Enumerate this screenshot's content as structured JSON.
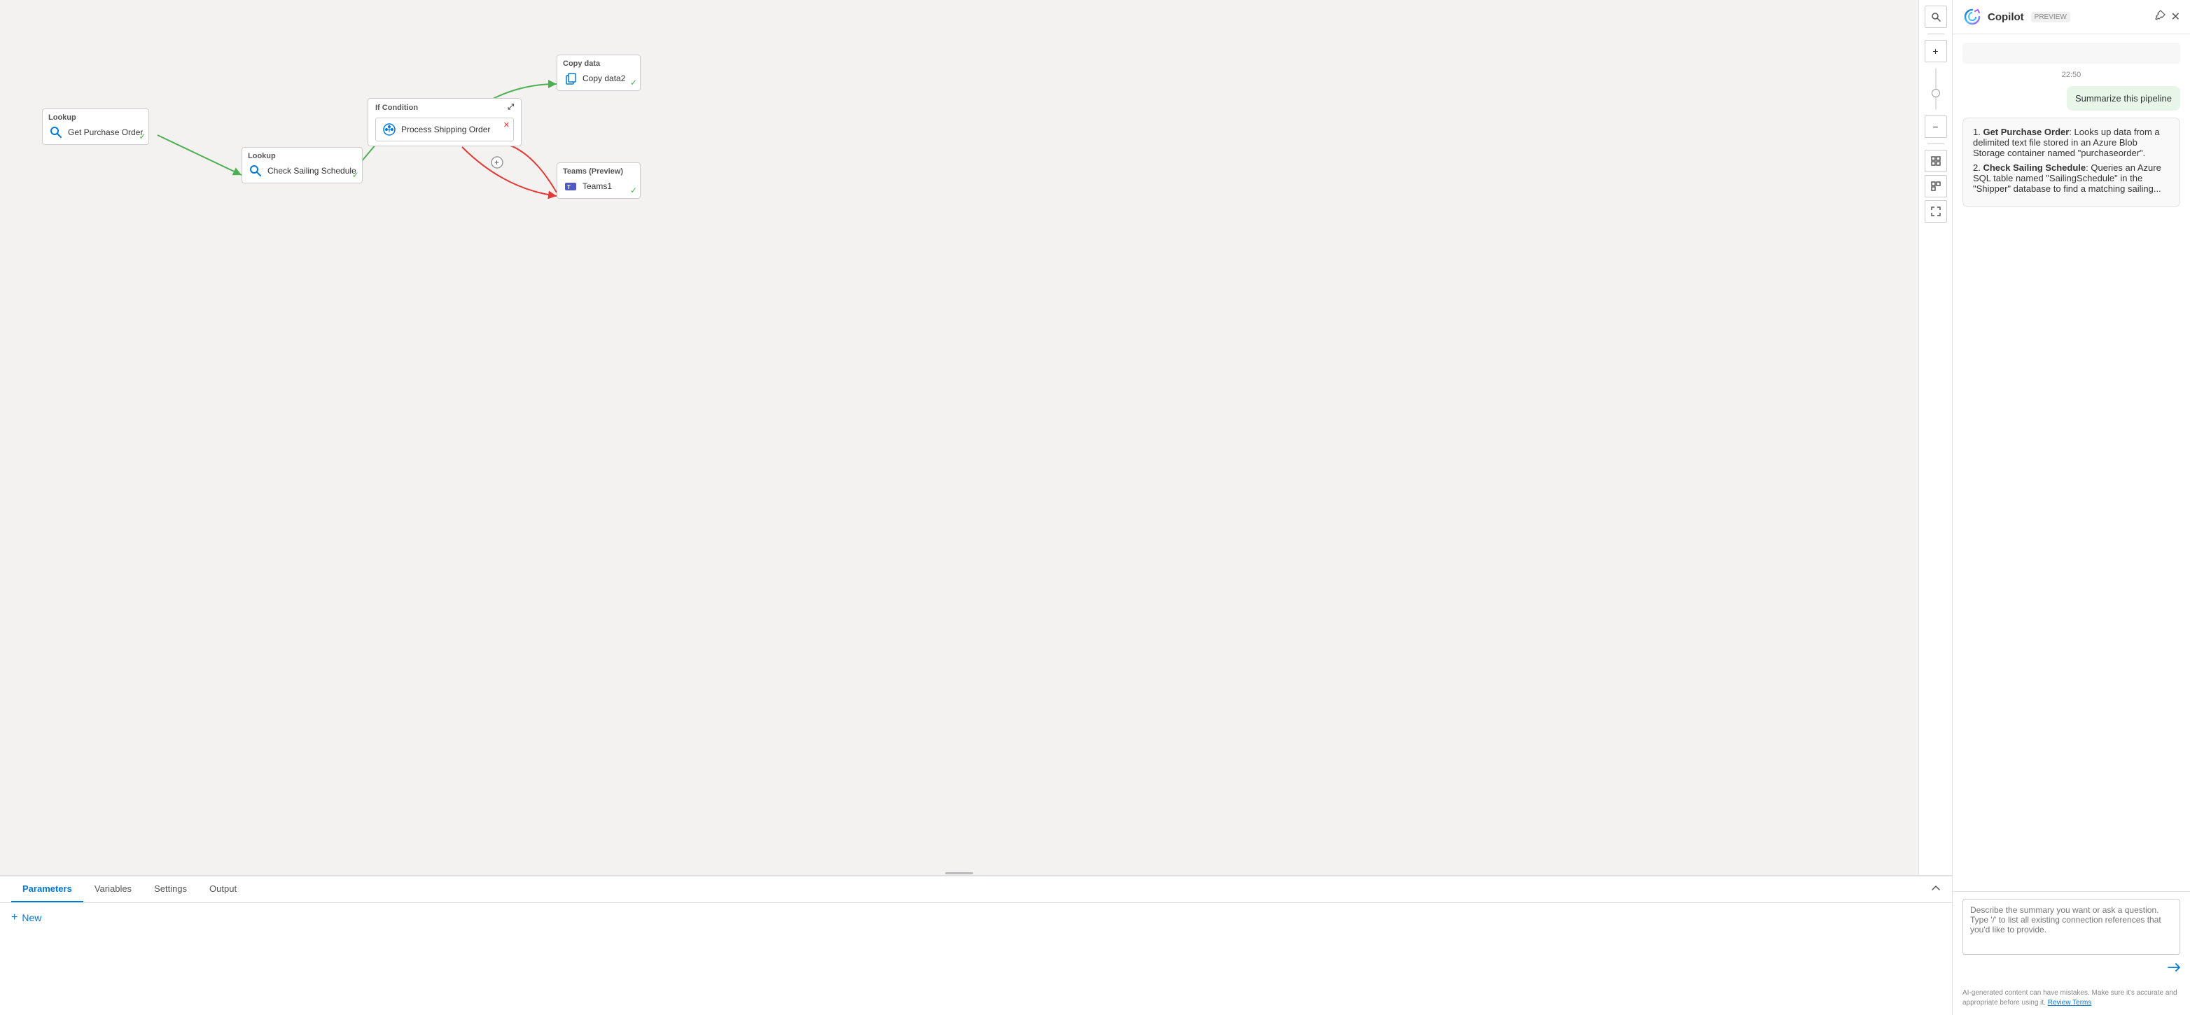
{
  "canvas_toolbar": {
    "search_icon": "🔍",
    "zoom_in_icon": "+",
    "zoom_out_icon": "−",
    "fit_icon": "⊡",
    "group_icon": "⊞",
    "expand_icon": "⤢"
  },
  "nodes": {
    "get_purchase": {
      "header": "Lookup",
      "label": "Get Purchase Order",
      "icon": "🔍"
    },
    "check_sailing": {
      "header": "Lookup",
      "label": "Check Sailing Schedule",
      "icon": "🔍"
    },
    "if_condition": {
      "header": "If Condition",
      "label": "If Condition"
    },
    "process_shipping": {
      "header": "",
      "label": "Process Shipping Order",
      "icon": "⚙"
    },
    "copy_data": {
      "header": "Copy data",
      "label": "Copy data2",
      "icon": "📋"
    },
    "teams": {
      "header": "Teams (Preview)",
      "label": "Teams1",
      "icon": "👥"
    }
  },
  "bottom_panel": {
    "tabs": [
      "Parameters",
      "Variables",
      "Settings",
      "Output"
    ],
    "active_tab": "Parameters",
    "new_button": "New"
  },
  "copilot": {
    "title": "Copilot",
    "preview_badge": "PREVIEW",
    "timestamp": "22:50",
    "user_message": "Summarize this pipeline",
    "response": {
      "items": [
        {
          "num": "1",
          "title": "Get Purchase Order",
          "colon": ":",
          "text": " Looks up data from a delimited text file stored in an Azure Blob Storage container named \"purchaseorder\"."
        },
        {
          "num": "2",
          "title": "Check Sailing Schedule",
          "colon": ":",
          "text": " Queries an Azure SQL table named \"SailingSchedule\" in the \"Shipper\" database to find a matching sailing..."
        }
      ]
    },
    "input_placeholder": "Describe the summary you want or ask a question.\nType '/' to list all existing connection references that you'd like to provide.",
    "disclaimer": "AI-generated content can have mistakes. Make sure it's accurate and appropriate before using it.",
    "review_terms": "Review Terms"
  }
}
